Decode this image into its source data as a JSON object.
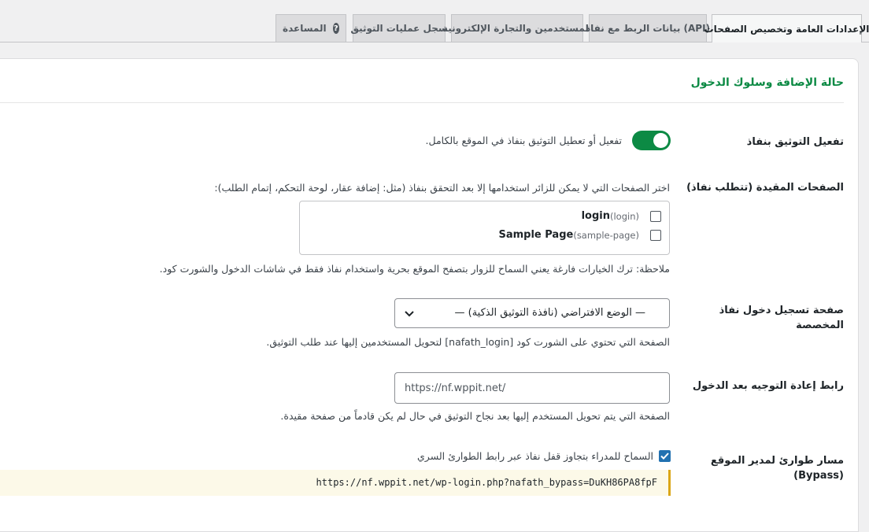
{
  "tabs": [
    {
      "label": "الإعدادات العامة وتخصيص الصفحات",
      "active": true
    },
    {
      "label": "بيانات الربط مع نفاذ (API)",
      "active": false
    },
    {
      "label": "المستخدمين والتجارة الإلكترونية",
      "active": false
    },
    {
      "label": "سجل عمليات التوثيق",
      "active": false
    },
    {
      "label": "المساعدة",
      "active": false,
      "icon": "help-icon"
    }
  ],
  "section": {
    "title": "حالة الإضافة وسلوك الدخول"
  },
  "enable": {
    "label": "تفعيل التوثيق بنفاذ",
    "description": "تفعيل أو تعطيل التوثيق بنفاذ في الموقع بالكامل.",
    "enabled": true
  },
  "restricted": {
    "label": "الصفحات المقيدة (تتطلب نفاذ)",
    "description": "اختر الصفحات التي لا يمكن للزائر استخدامها إلا بعد التحقق بنفاذ (مثل: إضافة عقار، لوحة التحكم، إتمام الطلب):",
    "pages": [
      {
        "title": "login",
        "slug": "(login)",
        "checked": false
      },
      {
        "title": "Sample Page",
        "slug": "(sample-page)",
        "checked": false
      }
    ],
    "note": "ملاحظة: ترك الخيارات فارغة يعني السماح للزوار بتصفح الموقع بحرية واستخدام نفاذ فقط في شاشات الدخول والشورت كود."
  },
  "login_page": {
    "label": "صفحة تسجيل دخول نفاذ المخصصة",
    "selected": "— الوضع الافتراضي (نافذة التوثيق الذكية) —",
    "description": "الصفحة التي تحتوي على الشورت كود [nafath_login] لتحويل المستخدمين إليها عند طلب التوثيق."
  },
  "redirect": {
    "label": "رابط إعادة التوجيه بعد الدخول",
    "value": "https://nf.wppit.net/",
    "description": "الصفحة التي يتم تحويل المستخدم إليها بعد نجاح التوثيق في حال لم يكن قادماً من صفحة مقيدة."
  },
  "bypass": {
    "label": "مسار طوارئ لمدير الموقع (Bypass)",
    "checkbox_label": "السماح للمدراء بتجاوز قفل نفاذ عبر رابط الطوارئ السري",
    "checked": true,
    "url": "https://nf.wppit.net/wp-login.php?nafath_bypass=DuKH86PA8fpF"
  },
  "colors": {
    "accent": "#0c8a44",
    "checkbox": "#2271b1",
    "warning": "#dba617"
  }
}
